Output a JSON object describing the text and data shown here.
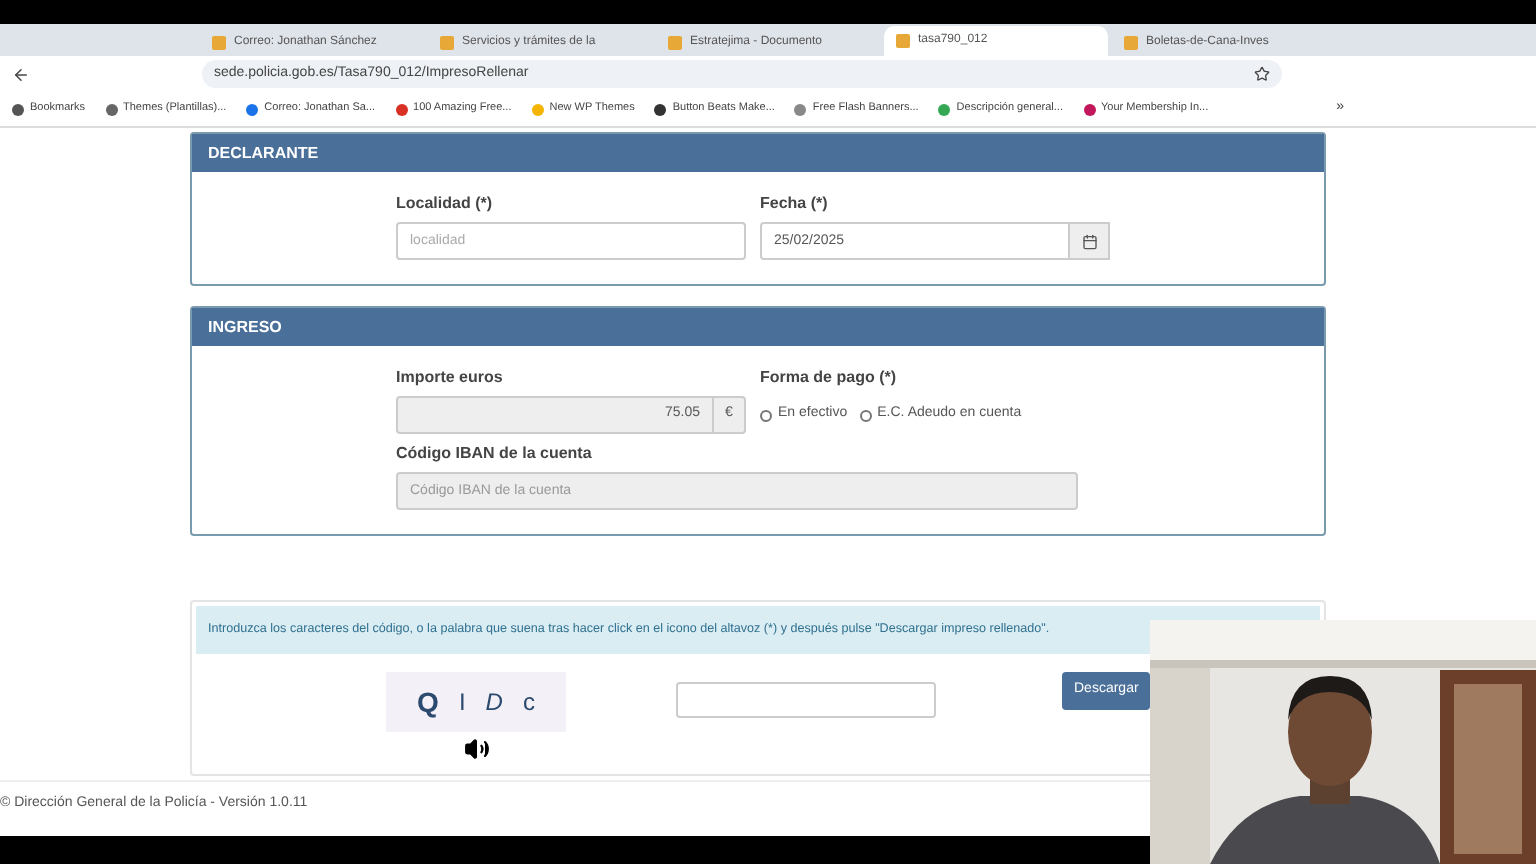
{
  "browser": {
    "tabs": [
      {
        "title": "Correo: Jonathan Sánchez",
        "selected": false
      },
      {
        "title": "Servicios y trámites de la",
        "selected": false
      },
      {
        "title": "Estratejima - Documento",
        "selected": false
      },
      {
        "title": "tasa790_012",
        "selected": true
      },
      {
        "title": "Boletas-de-Cana-Inves",
        "selected": false
      }
    ],
    "url": "sede.policia.gob.es/Tasa790_012/ImpresoRellenar",
    "bookmarks": [
      {
        "label": "Bookmarks",
        "color": "#555555"
      },
      {
        "label": "Themes (Plantillas)...",
        "color": "#666666"
      },
      {
        "label": "Correo: Jonathan Sa...",
        "color": "#1a73e8"
      },
      {
        "label": "100 Amazing Free...",
        "color": "#d93025"
      },
      {
        "label": "New WP Themes",
        "color": "#f4b400"
      },
      {
        "label": "Button Beats Make...",
        "color": "#333333"
      },
      {
        "label": "Free Flash Banners...",
        "color": "#888888"
      },
      {
        "label": "Descripción general...",
        "color": "#34a853"
      },
      {
        "label": "Your Membership In...",
        "color": "#c2185b"
      }
    ],
    "more": "»"
  },
  "declarante": {
    "title": "DECLARANTE",
    "localidad": {
      "label": "Localidad (*)",
      "placeholder": "localidad"
    },
    "fecha": {
      "label": "Fecha (*)",
      "value": "25/02/2025"
    }
  },
  "ingreso": {
    "title": "INGRESO",
    "importe": {
      "label": "Importe euros",
      "value": "75.05",
      "unit": "€"
    },
    "forma_pago": {
      "label": "Forma de pago (*)",
      "options": [
        {
          "label": "En efectivo",
          "selected": false
        },
        {
          "label": "E.C. Adeudo en cuenta",
          "selected": false
        }
      ]
    },
    "iban": {
      "label": "Código IBAN de la cuenta",
      "placeholder": "Código IBAN de la cuenta"
    }
  },
  "captcha": {
    "instructions": "Introduzca los caracteres del código, o la palabra que suena tras hacer click en el icono del altavoz (*) y después pulse \"Descargar impreso rellenado\".",
    "characters": [
      "Q",
      "I",
      "D",
      "c"
    ],
    "button": "Descargar"
  },
  "footer": "© Dirección General de la Policía - Versión 1.0.11"
}
